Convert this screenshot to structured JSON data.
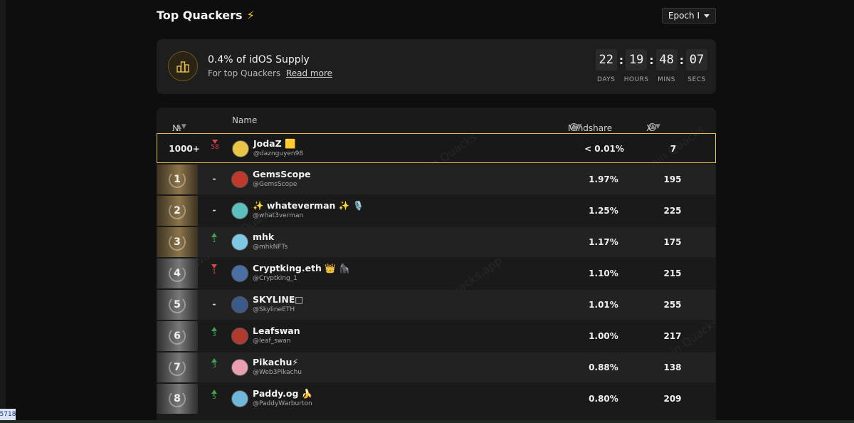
{
  "header": {
    "title": "Top Quackers",
    "epoch_label": "Epoch I"
  },
  "supply": {
    "headline": "0.4% of idOS Supply",
    "sub": "For top Quackers",
    "link": "Read more"
  },
  "countdown": [
    {
      "value": "22",
      "label": "DAYS"
    },
    {
      "value": "19",
      "label": "HOURS"
    },
    {
      "value": "48",
      "label": "MINS"
    },
    {
      "value": "07",
      "label": "SECS"
    }
  ],
  "table": {
    "col_rank": "№",
    "col_name": "Name",
    "col_mindshare": "Mindshare",
    "col_xscore": "X Score"
  },
  "current_user": {
    "rank": "1000+",
    "change_dir": "down",
    "change": "58",
    "name": "JodaZ 🟨",
    "handle": "@daznguyen98",
    "mindshare": "< 0.01%",
    "xscore": "7"
  },
  "rows": [
    {
      "rank": "1",
      "tier": "gold",
      "change_dir": "none",
      "change": "-",
      "name": "GemsScope",
      "handle": "@GemsScope",
      "mindshare": "1.97%",
      "xscore": "195",
      "avatar_color": "#c0392b"
    },
    {
      "rank": "2",
      "tier": "gold",
      "change_dir": "none",
      "change": "-",
      "name": "✨ whateverman ✨ 🎙️",
      "handle": "@what3verman",
      "mindshare": "1.25%",
      "xscore": "225",
      "avatar_color": "#5bc0be"
    },
    {
      "rank": "3",
      "tier": "gold",
      "change_dir": "up",
      "change": "1",
      "name": "mhk",
      "handle": "@mhkNFTs",
      "mindshare": "1.17%",
      "xscore": "175",
      "avatar_color": "#7ec8e3"
    },
    {
      "rank": "4",
      "tier": "silver",
      "change_dir": "down",
      "change": "1",
      "name": "Cryptking.eth 👑 🦍",
      "handle": "@Cryptking_1",
      "mindshare": "1.10%",
      "xscore": "215",
      "avatar_color": "#4a6fa5"
    },
    {
      "rank": "5",
      "tier": "silver",
      "change_dir": "none",
      "change": "-",
      "name": "SKYLINE□",
      "handle": "@SkylineETH",
      "mindshare": "1.01%",
      "xscore": "255",
      "avatar_color": "#3b5a8a"
    },
    {
      "rank": "6",
      "tier": "silver",
      "change_dir": "up",
      "change": "3",
      "name": "Leafswan",
      "handle": "@leaf_swan",
      "mindshare": "1.00%",
      "xscore": "217",
      "avatar_color": "#b03a2e"
    },
    {
      "rank": "7",
      "tier": "silver",
      "change_dir": "up",
      "change": "3",
      "name": "Pikachu⚡",
      "handle": "@Web3Pikachu",
      "mindshare": "0.88%",
      "xscore": "138",
      "avatar_color": "#e8a0b0"
    },
    {
      "rank": "8",
      "tier": "silver",
      "change_dir": "up",
      "change": "5",
      "name": "Paddy.og 🍌",
      "handle": "@PaddyWarburton",
      "mindshare": "0.80%",
      "xscore": "209",
      "avatar_color": "#6fb7d8"
    }
  ],
  "watermarks": [
    "Wallchain Quacks",
    "quacks.app"
  ],
  "corner_tag": "5718",
  "colors": {
    "accent_gold": "#e0c04a",
    "up": "#3fa34d",
    "down": "#d64545",
    "bolt": "#f5c518"
  }
}
